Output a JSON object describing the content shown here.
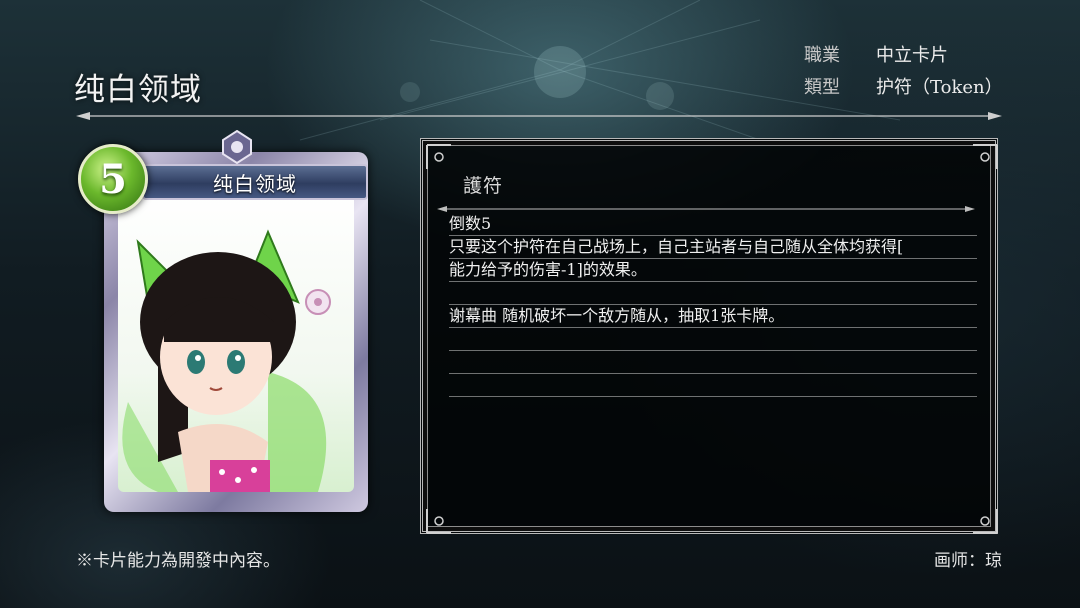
{
  "card": {
    "name": "纯白领域",
    "cost": "5"
  },
  "meta": {
    "class_label": "職業",
    "class_value": "中立卡片",
    "type_label": "類型",
    "type_value": "护符（Token）"
  },
  "panel": {
    "type_heading": "護符",
    "lines": [
      "倒数5",
      "只要这个护符在自己战场上，自己主站者与自己随从全体均获得[",
      "能力给予的伤害-1]的效果。",
      "",
      "谢幕曲 随机破坏一个敌方随从，抽取1张卡牌。",
      "",
      "",
      ""
    ]
  },
  "footer": {
    "note": "※卡片能力為開發中內容。",
    "artist": "画师：琼"
  },
  "colors": {
    "cost_green": "#6bb82c",
    "banner_blue": "#2e3d60",
    "panel_bg": "#020406"
  }
}
